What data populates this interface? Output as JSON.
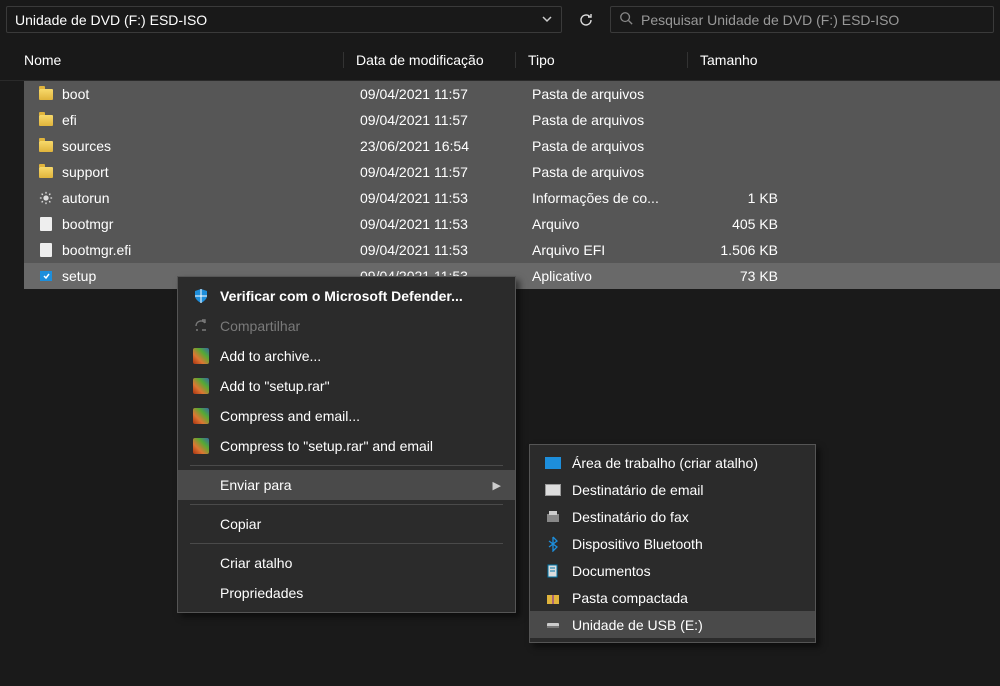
{
  "address": {
    "path": "Unidade de DVD (F:) ESD-ISO"
  },
  "search": {
    "placeholder": "Pesquisar Unidade de DVD (F:) ESD-ISO"
  },
  "columns": {
    "name": "Nome",
    "modified": "Data de modificação",
    "type": "Tipo",
    "size": "Tamanho"
  },
  "rows": [
    {
      "icon": "folder",
      "name": "boot",
      "modified": "09/04/2021 11:57",
      "type": "Pasta de arquivos",
      "size": ""
    },
    {
      "icon": "folder",
      "name": "efi",
      "modified": "09/04/2021 11:57",
      "type": "Pasta de arquivos",
      "size": ""
    },
    {
      "icon": "folder",
      "name": "sources",
      "modified": "23/06/2021 16:54",
      "type": "Pasta de arquivos",
      "size": ""
    },
    {
      "icon": "folder",
      "name": "support",
      "modified": "09/04/2021 11:57",
      "type": "Pasta de arquivos",
      "size": ""
    },
    {
      "icon": "gear",
      "name": "autorun",
      "modified": "09/04/2021 11:53",
      "type": "Informações de co...",
      "size": "1 KB"
    },
    {
      "icon": "file",
      "name": "bootmgr",
      "modified": "09/04/2021 11:53",
      "type": "Arquivo",
      "size": "405 KB"
    },
    {
      "icon": "file",
      "name": "bootmgr.efi",
      "modified": "09/04/2021 11:53",
      "type": "Arquivo EFI",
      "size": "1.506 KB"
    },
    {
      "icon": "app",
      "name": "setup",
      "modified": "09/04/2021 11:53",
      "type": "Aplicativo",
      "size": "73 KB"
    }
  ],
  "menu": {
    "defender": "Verificar com o Microsoft Defender...",
    "share": "Compartilhar",
    "add_archive": "Add to archive...",
    "add_setup_rar": "Add to \"setup.rar\"",
    "compress_email": "Compress and email...",
    "compress_setup_email": "Compress to \"setup.rar\" and email",
    "send_to": "Enviar para",
    "copy": "Copiar",
    "shortcut": "Criar atalho",
    "properties": "Propriedades"
  },
  "submenu": {
    "desktop": "Área de trabalho (criar atalho)",
    "email": "Destinatário de email",
    "fax": "Destinatário do fax",
    "bluetooth": "Dispositivo Bluetooth",
    "documents": "Documentos",
    "zip": "Pasta compactada",
    "usb": "Unidade de USB (E:)"
  }
}
